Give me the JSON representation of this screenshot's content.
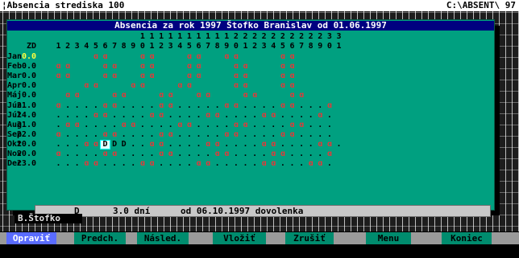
{
  "topbar": {
    "left": "¦Absencia strediska 100",
    "right": "C:\\ABSENT\\ 97"
  },
  "window": {
    "title": "Absencia za rok 1997 Štofko Branislav od 01.06.1997"
  },
  "header": {
    "tens": [
      "",
      "",
      "",
      "",
      "",
      "",
      "",
      "",
      "",
      "1",
      "1",
      "1",
      "1",
      "1",
      "1",
      "1",
      "1",
      "1",
      "1",
      "2",
      "2",
      "2",
      "2",
      "2",
      "2",
      "2",
      "2",
      "2",
      "2",
      "3",
      "3"
    ],
    "units": [
      "1",
      "2",
      "3",
      "4",
      "5",
      "6",
      "7",
      "8",
      "9",
      "0",
      "1",
      "2",
      "3",
      "4",
      "5",
      "6",
      "7",
      "8",
      "9",
      "0",
      "1",
      "2",
      "3",
      "4",
      "5",
      "6",
      "7",
      "8",
      "9",
      "0",
      "1"
    ],
    "zd_label": "ZD"
  },
  "months": [
    {
      "name": "Jan",
      "days": "    ss   ss   ss  ss    ss    ",
      "zd": "0.0"
    },
    {
      "name": "Feb",
      "days": "ss   ss  ss   ss   ss   ss    ",
      "zd": "0.0"
    },
    {
      "name": "Mar",
      "days": "ss   ss  ss   ss   ss   ss    ",
      "zd": "0.0"
    },
    {
      "name": "Apr",
      "days": "   ss   ss   ss    ss   ss    ",
      "zd": "0.0"
    },
    {
      "name": "Máj",
      "days": " ss   ss   ss  ss   ss   ss   ",
      "zd": "0.0"
    },
    {
      "name": "Jún",
      "days": "s....ss....ss.....ss....ss...s",
      "zd": "21.0"
    },
    {
      "name": "Júl",
      "days": "....ss....ss....ss....ss....s.",
      "zd": "24.0"
    },
    {
      "name": "Aug",
      "days": ".ss....ss....ss....ss....ss...",
      "zd": "21.0"
    },
    {
      "name": "Sep",
      "days": "s....ss....ss.....ss....ss....",
      "zd": "22.0"
    },
    {
      "name": "Okt",
      "days": "...ssDDD..ss....ss....ss....ss.",
      "zd": "20.0"
    },
    {
      "name": "Nov",
      "days": "s....ss....ss....ss....ss....s",
      "zd": "20.0"
    },
    {
      "name": "Dec",
      "days": "...ss....ss....ss.....ss...ss.",
      "zd": "23.0"
    }
  ],
  "status": {
    "code": "D",
    "amount": "3.0 dní",
    "from": "od 06.10.1997 dovolenka"
  },
  "name_box": "B.Štofko",
  "buttons": [
    {
      "label": "Opraviť",
      "active": true
    },
    {
      "label": "Predch.",
      "active": false
    },
    {
      "label": "Násled.",
      "active": false
    },
    {
      "label": "Vložiť",
      "active": false
    },
    {
      "label": "Zrušiť",
      "active": false
    },
    {
      "label": "Menu",
      "active": false
    },
    {
      "label": "Koniec",
      "active": false
    }
  ]
}
